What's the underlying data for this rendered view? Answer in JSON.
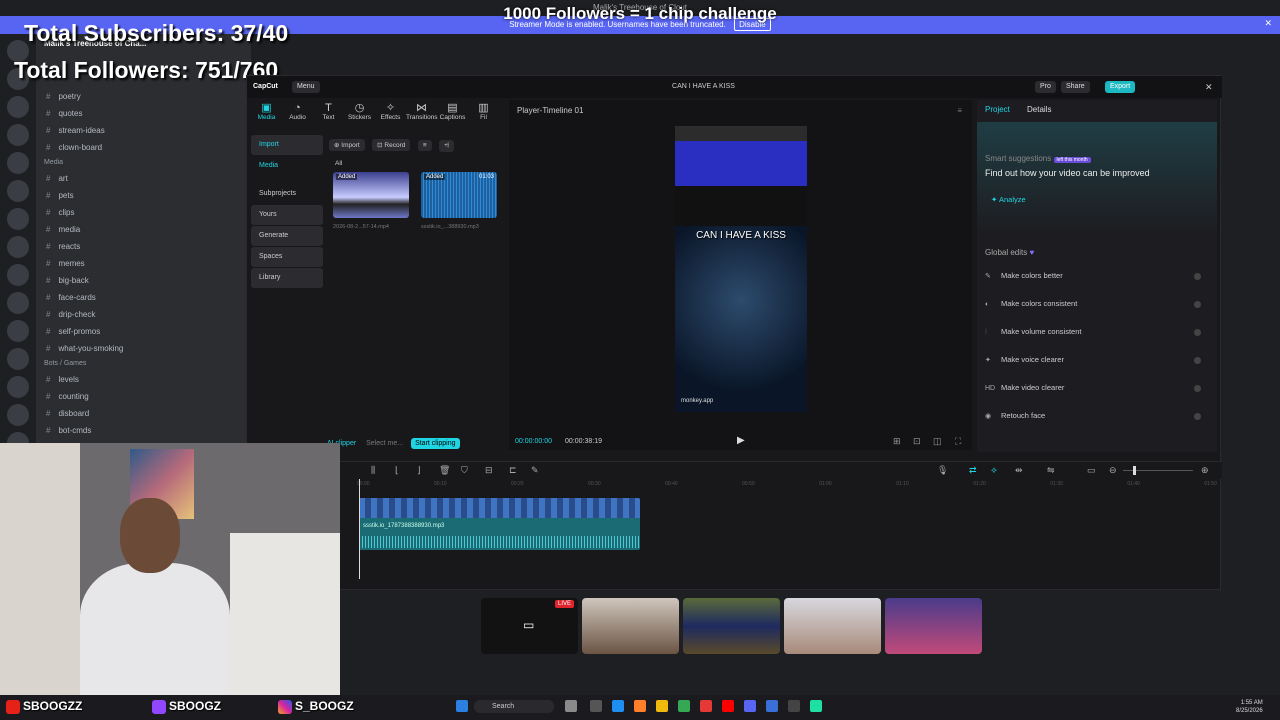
{
  "discord": {
    "window_title": "Malik's Treehouse of Clout",
    "streamer_notice": "Streamer Mode is enabled. Usernames have been truncated.",
    "disable_label": "Disable",
    "server_name": "Malik's Treehouse of Cha...",
    "channels": [
      {
        "name": "poetry"
      },
      {
        "name": "quotes"
      },
      {
        "name": "stream-ideas"
      },
      {
        "name": "clown-board"
      }
    ],
    "media_category": "Media",
    "media_channels": [
      {
        "name": "art"
      },
      {
        "name": "pets"
      },
      {
        "name": "clips"
      },
      {
        "name": "media"
      },
      {
        "name": "reacts"
      },
      {
        "name": "memes"
      },
      {
        "name": "big-back"
      },
      {
        "name": "face-cards"
      },
      {
        "name": "drip-check"
      },
      {
        "name": "self-promos"
      },
      {
        "name": "what-you-smoking"
      }
    ],
    "bots_category": "Bots / Games",
    "bot_channels": [
      {
        "name": "levels"
      },
      {
        "name": "counting"
      },
      {
        "name": "disboard"
      },
      {
        "name": "bot-cmds"
      }
    ]
  },
  "overlay": {
    "challenge": "1000 Followers = 1 chip challenge",
    "subscribers": "Total Subscribers: 37/40",
    "followers": "Total Followers: 751/760",
    "youtube": "SBOOGZZ",
    "twitch": "SBOOGZ",
    "instagram": "S_BOOGZ",
    "live_badge": "LIVE"
  },
  "capcut": {
    "logo": "CapCut",
    "menu": "Menu",
    "project_title": "CAN I HAVE A KISS",
    "pro_label": "Pro",
    "share_label": "Share",
    "export_label": "Export",
    "tools": [
      {
        "label": "Media",
        "icon": "▣"
      },
      {
        "label": "Audio",
        "icon": "◔"
      },
      {
        "label": "Text",
        "icon": "T"
      },
      {
        "label": "Stickers",
        "icon": "◷"
      },
      {
        "label": "Effects",
        "icon": "✧"
      },
      {
        "label": "Transitions",
        "icon": "⋈"
      },
      {
        "label": "Captions",
        "icon": "▤"
      },
      {
        "label": "Fil",
        "icon": "▥"
      }
    ],
    "nav": [
      "Import",
      "Media",
      "Subprojects",
      "Yours",
      "Generate",
      "Spaces",
      "Library"
    ],
    "import_btn": "Import",
    "record_btn": "Record",
    "filter_all": "All",
    "media_items": [
      {
        "tag": "Added",
        "name": "2026-08-2...57-14.mp4",
        "duration": ""
      },
      {
        "tag": "Added",
        "name": "ssstik.io_...388930.mp3",
        "duration": "01:03"
      }
    ],
    "ai_clipper": "AI clipper",
    "select_media": "Select me...",
    "start_clipping": "Start clipping",
    "player_title": "Player-Timeline 01",
    "video_caption": "CAN I HAVE A KISS",
    "video_watermark": "monkey.app",
    "time_current": "00:00:00:00",
    "time_total": "00:00:38:19",
    "tab_project": "Project",
    "tab_details": "Details",
    "smart_suggestions": "Smart suggestions",
    "smart_badge": "left this month",
    "suggest_main": "Find out how your video can be improved",
    "analyze": "Analyze",
    "global_edits": "Global edits",
    "edits": [
      {
        "label": "Make colors better",
        "icon": "✎"
      },
      {
        "label": "Make colors consistent",
        "icon": "◐"
      },
      {
        "label": "Make volume consistent",
        "icon": "⫶"
      },
      {
        "label": "Make voice clearer",
        "icon": "✦"
      },
      {
        "label": "Make video clearer",
        "icon": "HD"
      },
      {
        "label": "Retouch face",
        "icon": "◉"
      }
    ],
    "ruler": [
      "00:00",
      "00:10",
      "00:20",
      "00:30",
      "00:40",
      "00:50",
      "01:00",
      "01:10",
      "01:20",
      "01:30",
      "01:40",
      "01:50"
    ],
    "audio_track_name": "ssstik.io_1787388388930.mp3"
  },
  "taskbar": {
    "search": "Search",
    "time": "1:55 AM",
    "date": "8/25/2026"
  },
  "colors": {
    "accent": "#20d5e3",
    "discord_blurple": "#5865f2",
    "live_red": "#e0242e"
  }
}
